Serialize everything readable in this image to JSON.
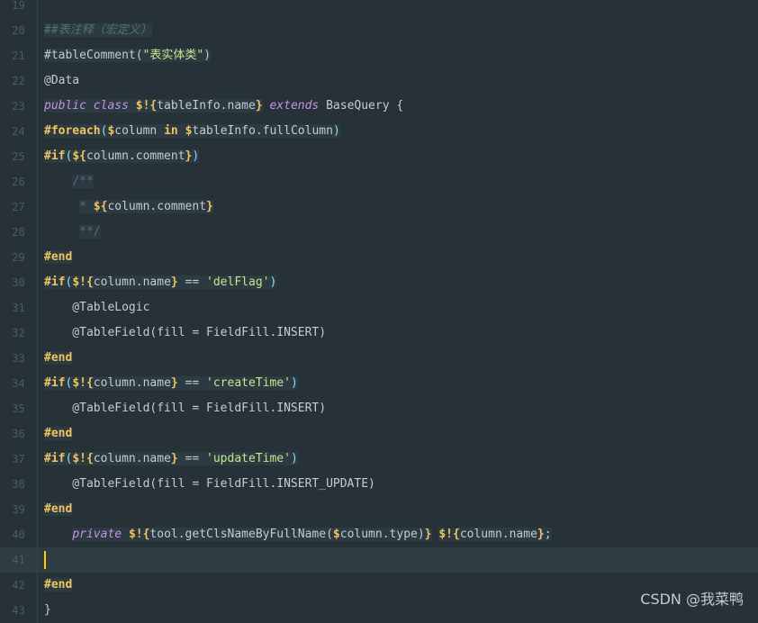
{
  "editor": {
    "lines": [
      {
        "num": "19",
        "tokens": []
      },
      {
        "num": "20",
        "tokens": [
          {
            "t": "##表注释（宏定义）",
            "c": "t-comment",
            "hl": true
          }
        ]
      },
      {
        "num": "21",
        "tokens": [
          {
            "t": "#tableComment(",
            "c": "t-plain",
            "hl": true
          },
          {
            "t": "\"表实体类\"",
            "c": "t-string-cn",
            "hl": true
          },
          {
            "t": ")",
            "c": "t-plain",
            "hl": true
          }
        ]
      },
      {
        "num": "22",
        "tokens": [
          {
            "t": "@Data",
            "c": "t-plain"
          }
        ]
      },
      {
        "num": "23",
        "tokens": [
          {
            "t": "public class ",
            "c": "t-keyword",
            "hl": true
          },
          {
            "t": "$!{",
            "c": "t-var",
            "hl": true
          },
          {
            "t": "tableInfo.name",
            "c": "t-varname",
            "hl": true
          },
          {
            "t": "}",
            "c": "t-var",
            "hl": true
          },
          {
            "t": " extends ",
            "c": "t-keyword"
          },
          {
            "t": "BaseQuery {",
            "c": "t-plain"
          }
        ]
      },
      {
        "num": "24",
        "tokens": [
          {
            "t": "#foreach",
            "c": "t-directive",
            "hl": true
          },
          {
            "t": "(",
            "c": "t-paren",
            "hl": true
          },
          {
            "t": "$",
            "c": "t-var",
            "hl": true
          },
          {
            "t": "column ",
            "c": "t-varname",
            "hl": true
          },
          {
            "t": "in ",
            "c": "t-directive",
            "hl": true
          },
          {
            "t": "$",
            "c": "t-var",
            "hl": true
          },
          {
            "t": "tableInfo.fullColumn",
            "c": "t-varname",
            "hl": true
          },
          {
            "t": ")",
            "c": "t-paren",
            "hl": true
          }
        ]
      },
      {
        "num": "25",
        "tokens": [
          {
            "t": "#if",
            "c": "t-directive",
            "hl": true
          },
          {
            "t": "(",
            "c": "t-paren",
            "hl": true
          },
          {
            "t": "${",
            "c": "t-var",
            "hl": true
          },
          {
            "t": "column.comment",
            "c": "t-varname",
            "hl": true
          },
          {
            "t": "}",
            "c": "t-var",
            "hl": true
          },
          {
            "t": ")",
            "c": "t-paren",
            "hl": true
          }
        ]
      },
      {
        "num": "26",
        "tokens": [
          {
            "t": "    ",
            "c": "t-plain"
          },
          {
            "t": "/**",
            "c": "t-comment-plain",
            "hl": true
          }
        ]
      },
      {
        "num": "27",
        "tokens": [
          {
            "t": "     ",
            "c": "t-plain"
          },
          {
            "t": "* ",
            "c": "t-comment-plain",
            "hl": true
          },
          {
            "t": "${",
            "c": "t-var",
            "hl": true
          },
          {
            "t": "column.comment",
            "c": "t-varname",
            "hl": true
          },
          {
            "t": "}",
            "c": "t-var",
            "hl": true
          }
        ]
      },
      {
        "num": "28",
        "tokens": [
          {
            "t": "     ",
            "c": "t-plain"
          },
          {
            "t": "**/",
            "c": "t-comment-plain",
            "hl": true
          }
        ]
      },
      {
        "num": "29",
        "tokens": [
          {
            "t": "#end",
            "c": "t-directive",
            "hl": true
          }
        ]
      },
      {
        "num": "30",
        "tokens": [
          {
            "t": "#if",
            "c": "t-directive",
            "hl": true
          },
          {
            "t": "(",
            "c": "t-paren",
            "hl": true
          },
          {
            "t": "$!{",
            "c": "t-var",
            "hl": true
          },
          {
            "t": "column.name",
            "c": "t-varname",
            "hl": true
          },
          {
            "t": "}",
            "c": "t-var",
            "hl": true
          },
          {
            "t": " == ",
            "c": "t-plain",
            "hl": true
          },
          {
            "t": "'delFlag'",
            "c": "t-string",
            "hl": true
          },
          {
            "t": ")",
            "c": "t-paren",
            "hl": true
          }
        ]
      },
      {
        "num": "31",
        "tokens": [
          {
            "t": "    @TableLogic",
            "c": "t-plain"
          }
        ]
      },
      {
        "num": "32",
        "tokens": [
          {
            "t": "    @TableField(fill = FieldFill.INSERT)",
            "c": "t-plain"
          }
        ]
      },
      {
        "num": "33",
        "tokens": [
          {
            "t": "#end",
            "c": "t-directive",
            "hl": true
          }
        ]
      },
      {
        "num": "34",
        "tokens": [
          {
            "t": "#if",
            "c": "t-directive",
            "hl": true
          },
          {
            "t": "(",
            "c": "t-paren",
            "hl": true
          },
          {
            "t": "$!{",
            "c": "t-var",
            "hl": true
          },
          {
            "t": "column.name",
            "c": "t-varname",
            "hl": true
          },
          {
            "t": "}",
            "c": "t-var",
            "hl": true
          },
          {
            "t": " == ",
            "c": "t-plain",
            "hl": true
          },
          {
            "t": "'createTime'",
            "c": "t-string",
            "hl": true
          },
          {
            "t": ")",
            "c": "t-paren",
            "hl": true
          }
        ]
      },
      {
        "num": "35",
        "tokens": [
          {
            "t": "    @TableField(fill = FieldFill.INSERT)",
            "c": "t-plain"
          }
        ]
      },
      {
        "num": "36",
        "tokens": [
          {
            "t": "#end",
            "c": "t-directive",
            "hl": true
          }
        ]
      },
      {
        "num": "37",
        "tokens": [
          {
            "t": "#if",
            "c": "t-directive",
            "hl": true
          },
          {
            "t": "(",
            "c": "t-paren",
            "hl": true
          },
          {
            "t": "$!{",
            "c": "t-var",
            "hl": true
          },
          {
            "t": "column.name",
            "c": "t-varname",
            "hl": true
          },
          {
            "t": "}",
            "c": "t-var",
            "hl": true
          },
          {
            "t": " == ",
            "c": "t-plain",
            "hl": true
          },
          {
            "t": "'updateTime'",
            "c": "t-string",
            "hl": true
          },
          {
            "t": ")",
            "c": "t-paren",
            "hl": true
          }
        ]
      },
      {
        "num": "38",
        "tokens": [
          {
            "t": "    @TableField(fill = FieldFill.INSERT_UPDATE)",
            "c": "t-plain"
          }
        ]
      },
      {
        "num": "39",
        "tokens": [
          {
            "t": "#end",
            "c": "t-directive",
            "hl": true
          }
        ]
      },
      {
        "num": "40",
        "tokens": [
          {
            "t": "    ",
            "c": "t-plain"
          },
          {
            "t": "private ",
            "c": "t-keyword",
            "hl": true
          },
          {
            "t": "$!{",
            "c": "t-var",
            "hl": true
          },
          {
            "t": "tool.getClsNameByFullName(",
            "c": "t-varname",
            "hl": true
          },
          {
            "t": "$",
            "c": "t-var",
            "hl": true
          },
          {
            "t": "column.type)",
            "c": "t-varname",
            "hl": true
          },
          {
            "t": "}",
            "c": "t-var",
            "hl": true
          },
          {
            "t": " ",
            "c": "t-plain"
          },
          {
            "t": "$!{",
            "c": "t-var",
            "hl": true
          },
          {
            "t": "column.name",
            "c": "t-varname",
            "hl": true
          },
          {
            "t": "}",
            "c": "t-var",
            "hl": true
          },
          {
            "t": ";",
            "c": "t-plain",
            "hl": true
          }
        ]
      },
      {
        "num": "41",
        "tokens": [],
        "current": true
      },
      {
        "num": "42",
        "tokens": [
          {
            "t": "#end",
            "c": "t-directive",
            "hl": true
          }
        ]
      },
      {
        "num": "43",
        "tokens": [
          {
            "t": "}",
            "c": "t-plain"
          }
        ]
      }
    ]
  },
  "colors": {
    "background": "#263238",
    "current_line": "#2e3c43",
    "caret": "#ffcc00",
    "directive": "#f2c35f",
    "keyword": "#c792ea",
    "string": "#c3e88d",
    "comment": "#546e7a"
  },
  "watermark": "CSDN @我菜鸭"
}
